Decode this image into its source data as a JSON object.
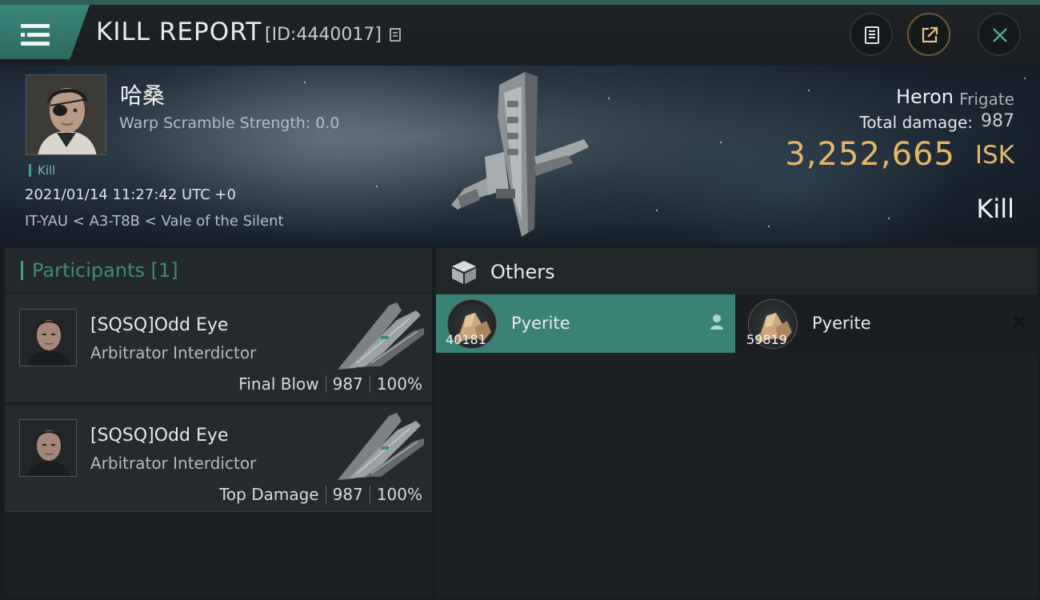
{
  "header": {
    "title": "KILL REPORT",
    "report_id": "[ID:4440017]",
    "icons": [
      "menu-icon",
      "copy-icon",
      "notes-icon",
      "share-icon",
      "close-icon"
    ]
  },
  "victim": {
    "name": "哈桑",
    "warp_scramble": "Warp Scramble Strength: 0.0",
    "kill_tag": "Kill",
    "datetime": "2021/01/14 11:27:42 UTC +0",
    "location": "IT-YAU < A3-T8B < Vale of the Silent",
    "ship_name": "Heron",
    "ship_class": "Frigate",
    "total_damage_label": "Total damage:",
    "total_damage": "987",
    "isk_value": "3,252,665",
    "isk_unit": "ISK",
    "result": "Kill"
  },
  "participants": {
    "header": "Participants [1]",
    "rows": [
      {
        "name": "[SQSQ]Odd Eye",
        "ship": "Arbitrator Interdictor",
        "role": "Final Blow",
        "damage": "987",
        "percent": "100%"
      },
      {
        "name": "[SQSQ]Odd Eye",
        "ship": "Arbitrator Interdictor",
        "role": "Top Damage",
        "damage": "987",
        "percent": "100%"
      }
    ]
  },
  "others": {
    "header": "Others",
    "items": [
      {
        "name": "Pyerite",
        "qty": "40181",
        "selected": true
      },
      {
        "name": "Pyerite",
        "qty": "59819",
        "selected": false
      }
    ]
  },
  "colors": {
    "accent_teal": "#3a8176",
    "isk_gold": "#e6b769",
    "panel_bg": "#1c2023"
  }
}
